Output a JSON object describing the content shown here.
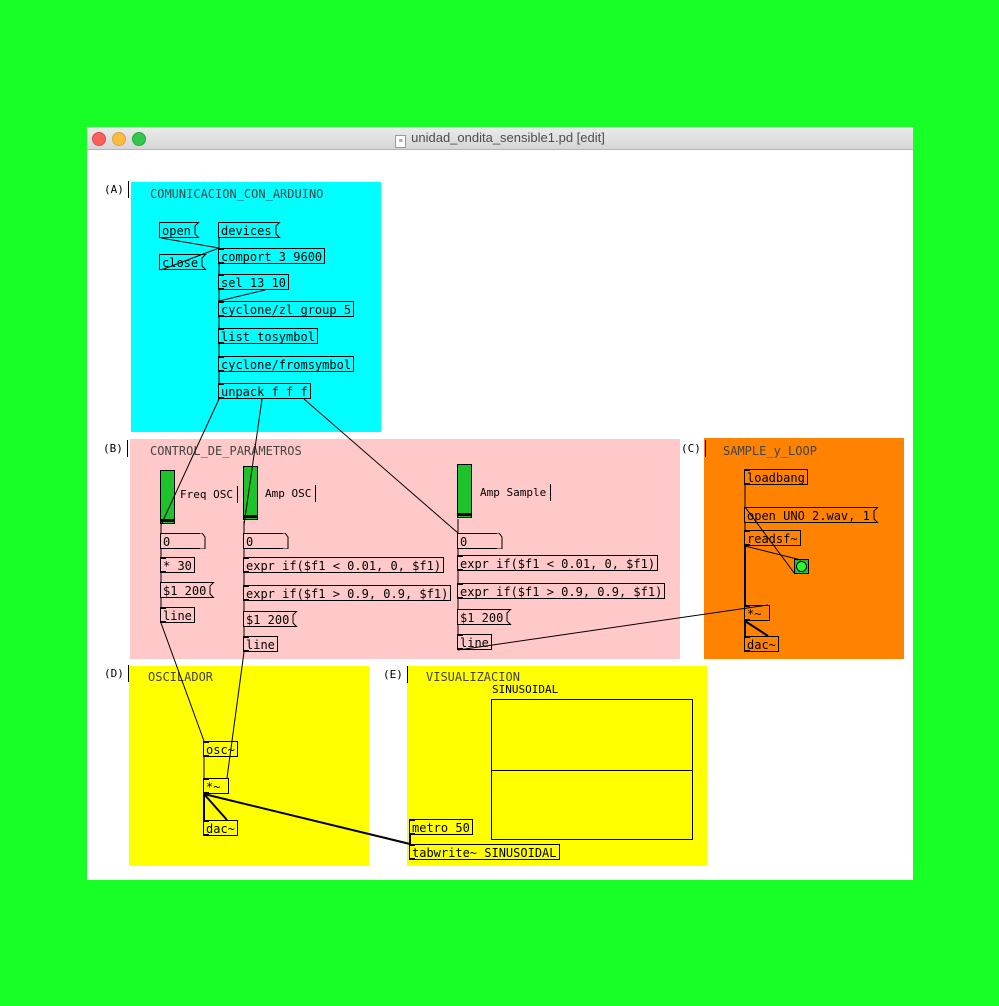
{
  "window": {
    "title": "unidad_ondita_sensible1.pd [edit]"
  },
  "colors": {
    "background": "#17ff26",
    "cyan": "#00ffff",
    "pink": "#ffc9c9",
    "orange": "#ff8200",
    "yellow": "#ffff00",
    "slider_green": "#1ec32c"
  },
  "sections": {
    "a": {
      "marker": "(A)",
      "title": "COMUNICACION_CON_ARDUINO"
    },
    "b": {
      "marker": "(B)",
      "title": "CONTROL_DE_PARÁMETROS"
    },
    "c": {
      "marker": "(C)",
      "title": "SAMPLE_y_LOOP"
    },
    "d": {
      "marker": "(D)",
      "title": "OSCILADOR"
    },
    "e": {
      "marker": "(E)",
      "title": "VISUALIZACION"
    }
  },
  "arduino": {
    "open_msg": "open",
    "close_msg": "close",
    "devices_msg": "devices",
    "comport": "comport 3 9600",
    "sel": "sel 13 10",
    "zl": "cyclone/zl group 5",
    "tosymbol": "list tosymbol",
    "fromsymbol": "cyclone/fromsymbol",
    "unpack": "unpack f f f"
  },
  "control": {
    "freq_label": "Freq OSC",
    "amp_label": "Amp OSC",
    "sample_label": "Amp Sample",
    "freq_num": "0",
    "amp_num": "0",
    "sample_num": "0",
    "mul30": "* 30",
    "freq_line_msg": "$1 200",
    "freq_line": "line",
    "amp_expr1": "expr if($f1 < 0.01, 0, $f1)",
    "amp_expr2": "expr if($f1 > 0.9, 0.9, $f1)",
    "amp_line_msg": "$1 200",
    "amp_line": "line",
    "sample_expr1": "expr if($f1 < 0.01, 0, $f1)",
    "sample_expr2": "expr if($f1 > 0.9, 0.9, $f1)",
    "sample_line_msg": "$1 200",
    "sample_line": "line"
  },
  "sample": {
    "loadbang": "loadbang",
    "open_msg": "open UNO_2.wav, 1",
    "readsf": "readsf~",
    "mul": "*~",
    "dac": "dac~"
  },
  "osc": {
    "osc": "osc~",
    "mul": "*~",
    "dac": "dac~"
  },
  "vis": {
    "array_name": "SINUSOIDAL",
    "metro": "metro 50",
    "tabwrite": "tabwrite~ SINUSOIDAL"
  }
}
